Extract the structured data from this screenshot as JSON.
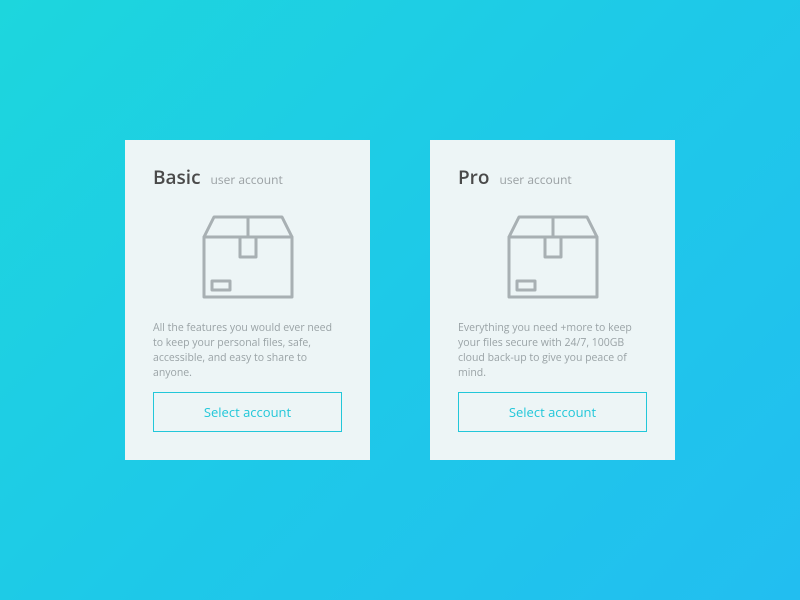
{
  "plans": [
    {
      "title": "Basic",
      "subtitle": "user account",
      "description": "All the features you would ever need to keep your personal files, safe, accessible, and easy to share to anyone.",
      "button_label": "Select account"
    },
    {
      "title": "Pro",
      "subtitle": "user account",
      "description": "Everything you need +more to keep your files secure with 24/7, 100GB cloud back-up to give you peace of mind.",
      "button_label": "Select account"
    }
  ],
  "colors": {
    "accent": "#22c7d9",
    "card_bg": "#edf5f6",
    "title": "#4a4a4a",
    "muted": "#9aa0a3"
  }
}
